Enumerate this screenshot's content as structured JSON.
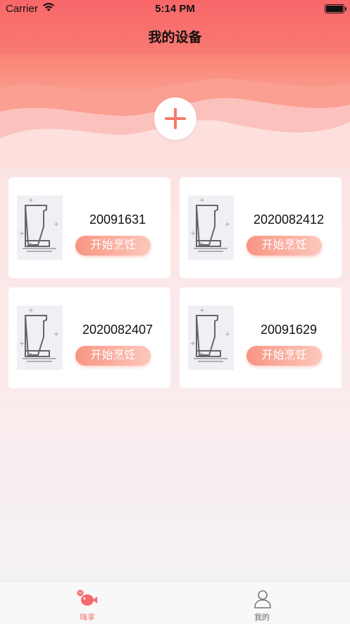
{
  "status_bar": {
    "carrier": "Carrier",
    "time": "5:14 PM"
  },
  "nav": {
    "title": "我的设备"
  },
  "devices": [
    {
      "id": "20091631",
      "action": "开始烹饪"
    },
    {
      "id": "2020082412",
      "action": "开始烹饪"
    },
    {
      "id": "2020082407",
      "action": "开始烹饪"
    },
    {
      "id": "20091629",
      "action": "开始烹饪"
    }
  ],
  "tabbar": {
    "tabs": [
      {
        "label": "嗨享",
        "icon": "fish-icon",
        "active": true
      },
      {
        "label": "我的",
        "icon": "person-icon",
        "active": false
      }
    ]
  },
  "colors": {
    "accent": "#f8676a",
    "button_gradient_start": "#f89583",
    "button_gradient_end": "#fcc7bc",
    "active_tab": "#f2756d"
  }
}
